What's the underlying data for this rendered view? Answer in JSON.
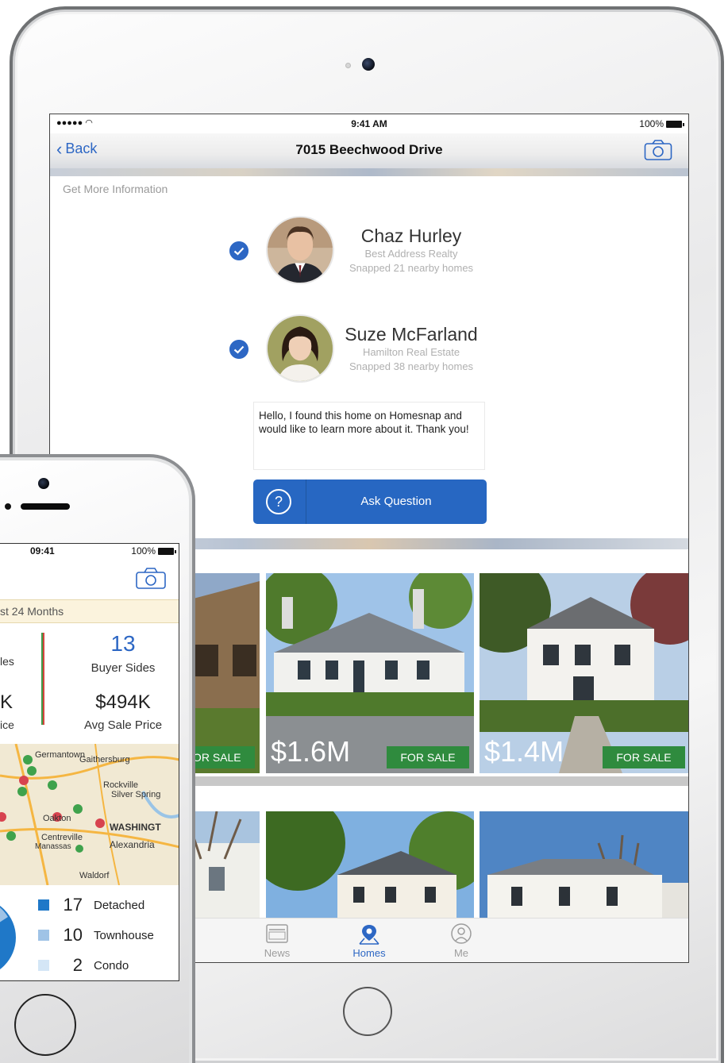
{
  "ipad": {
    "status": {
      "signal": "●●●●● ",
      "time": "9:41 AM",
      "battery": "100%"
    },
    "nav": {
      "back_label": "Back",
      "title": "7015 Beechwood Drive"
    },
    "section_label": "Get More Information",
    "agents": [
      {
        "name": "Chaz Hurley",
        "company": "Best Address Realty",
        "snapped": "Snapped 21 nearby homes",
        "selected": true
      },
      {
        "name": "Suze McFarland",
        "company": "Hamilton Real Estate",
        "snapped": "Snapped 38 nearby homes",
        "selected": true
      }
    ],
    "message": "Hello, I found this home on Homesnap and would like to learn more about it. Thank you!",
    "ask_button": {
      "icon": "?",
      "label": "Ask Question"
    },
    "listings": [
      {
        "price": "",
        "tag": "FOR SALE"
      },
      {
        "price": "$1.6M",
        "tag": "FOR SALE"
      },
      {
        "price": "$1.4M",
        "tag": "FOR SALE"
      }
    ],
    "tabs": [
      {
        "label": "News",
        "icon": "news-icon",
        "active": false
      },
      {
        "label": "Homes",
        "icon": "map-pin-icon",
        "active": true
      },
      {
        "label": "Me",
        "icon": "person-icon",
        "active": false
      }
    ]
  },
  "iphone": {
    "status": {
      "time": "09:41",
      "battery": "100%"
    },
    "period": "st 24 Months",
    "stats": {
      "seller_label": "les",
      "buyer_value": "13",
      "buyer_label": "Buyer Sides",
      "seller_price_value": "K",
      "seller_price_label": "ice",
      "avg_price_value": "$494K",
      "avg_price_label": "Avg Sale Price"
    },
    "map_labels": [
      "Germantown",
      "Gaithersburg",
      "Rockville",
      "Silver Spring",
      "Oakton",
      "WASHINGT",
      "Centreville",
      "Alexandria",
      "Manassas",
      "Waldorf"
    ],
    "legend": [
      {
        "count": "17",
        "label": "Detached",
        "color": "#1f78c8"
      },
      {
        "count": "10",
        "label": "Townhouse",
        "color": "#9fc3e6"
      },
      {
        "count": "2",
        "label": "Condo",
        "color": "#d4e6f6"
      }
    ]
  }
}
